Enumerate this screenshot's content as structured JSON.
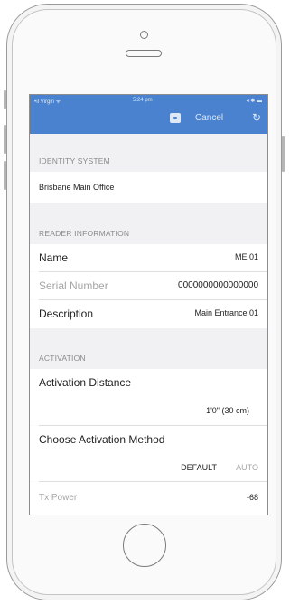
{
  "status_bar": {
    "carrier": "•ıl Virgin ᯤ",
    "time": "5:24 pm",
    "battery": "◂ ✱ ▬"
  },
  "toolbar": {
    "save_icon": "floppy-disk-icon",
    "cancel_label": "Cancel",
    "refresh_icon": "↻"
  },
  "identity_system": {
    "header": "IDENTITY SYSTEM",
    "value": "Brisbane Main Office"
  },
  "reader_information": {
    "header": "READER INFORMATION",
    "name_label": "Name",
    "name_value": "ME 01",
    "serial_label": "Serial Number",
    "serial_value": "0000000000000000",
    "description_label": "Description",
    "description_value": "Main Entrance  01"
  },
  "activation": {
    "header": "ACTIVATION",
    "distance_label": "Activation Distance",
    "distance_value": "1'0\" (30 cm)",
    "method_label": "Choose Activation Method",
    "method_default": "DEFAULT",
    "method_auto": "AUTO",
    "tx_label": "Tx Power",
    "tx_value": "-68"
  },
  "colors": {
    "header_blue": "#4a82cf",
    "section_bg": "#f1f1f3"
  }
}
